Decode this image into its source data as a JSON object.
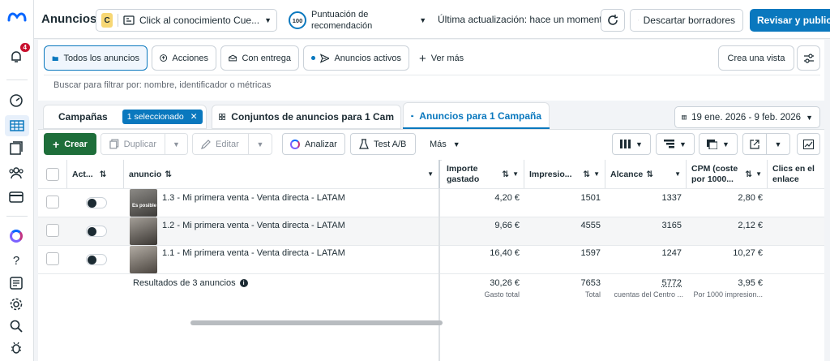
{
  "header": {
    "title": "Anuncios",
    "account_badge": "C",
    "campaign_selector": "Click al conocimiento Cue...",
    "score_value": "100",
    "score_label_1": "Puntuación de",
    "score_label_2": "recomendación",
    "last_update": "Última actualización: hace un momento",
    "discard_label": "Descartar borradores",
    "publish_label": "Revisar y publicar",
    "notifications_count": "4"
  },
  "filter_tabs": {
    "all_ads": "Todos los anuncios",
    "actions": "Acciones",
    "with_delivery": "Con entrega",
    "active_ads": "Anuncios activos",
    "see_more": "Ver más",
    "create_view": "Crea una vista"
  },
  "search": {
    "placeholder": "Buscar para filtrar por: nombre, identificador o métricas"
  },
  "level_tabs": {
    "campaigns": "Campañas",
    "selected_badge": "1 seleccionado",
    "adsets": "Conjuntos de anuncios para 1 Cam",
    "ads": "Anuncios para 1 Campaña",
    "date_range": "19 ene. 2026 - 9 feb. 2026"
  },
  "toolbar": {
    "create": "Crear",
    "duplicate": "Duplicar",
    "edit": "Editar",
    "analyze": "Analizar",
    "ab_test": "Test A/B",
    "more": "Más"
  },
  "table": {
    "headers": {
      "active": "Act...",
      "ad": "anuncio",
      "spent_1": "Importe",
      "spent_2": "gastado",
      "impressions": "Impresio...",
      "reach": "Alcance",
      "cpm_1": "CPM (coste",
      "cpm_2": "por 1000...",
      "clicks_1": "Clics en el",
      "clicks_2": "enlace"
    },
    "rows": [
      {
        "name": "1.3 - Mi primera venta - Venta directa - LATAM",
        "spent": "4,20 €",
        "impressions": "1501",
        "reach": "1337",
        "cpm": "2,80 €",
        "thumb_text": "Es posible"
      },
      {
        "name": "1.2 - Mi primera venta - Venta directa - LATAM",
        "spent": "9,66 €",
        "impressions": "4555",
        "reach": "3165",
        "cpm": "2,12 €",
        "thumb_text": ""
      },
      {
        "name": "1.1 - Mi primera venta - Venta directa - LATAM",
        "spent": "16,40 €",
        "impressions": "1597",
        "reach": "1247",
        "cpm": "10,27 €",
        "thumb_text": ""
      }
    ],
    "totals": {
      "label": "Resultados de 3 anuncios",
      "spent": "30,26 €",
      "spent_sub": "Gasto total",
      "impressions": "7653",
      "impressions_sub": "Total",
      "reach": "5772",
      "reach_sub": "cuentas del Centro ...",
      "cpm": "3,95 €",
      "cpm_sub": "Por 1000 impresion..."
    }
  },
  "colors": {
    "primary_blue": "#0a78be",
    "create_green": "#1e6e3a",
    "meta_blue": "#0866ff",
    "notification_red": "#c8102e"
  }
}
